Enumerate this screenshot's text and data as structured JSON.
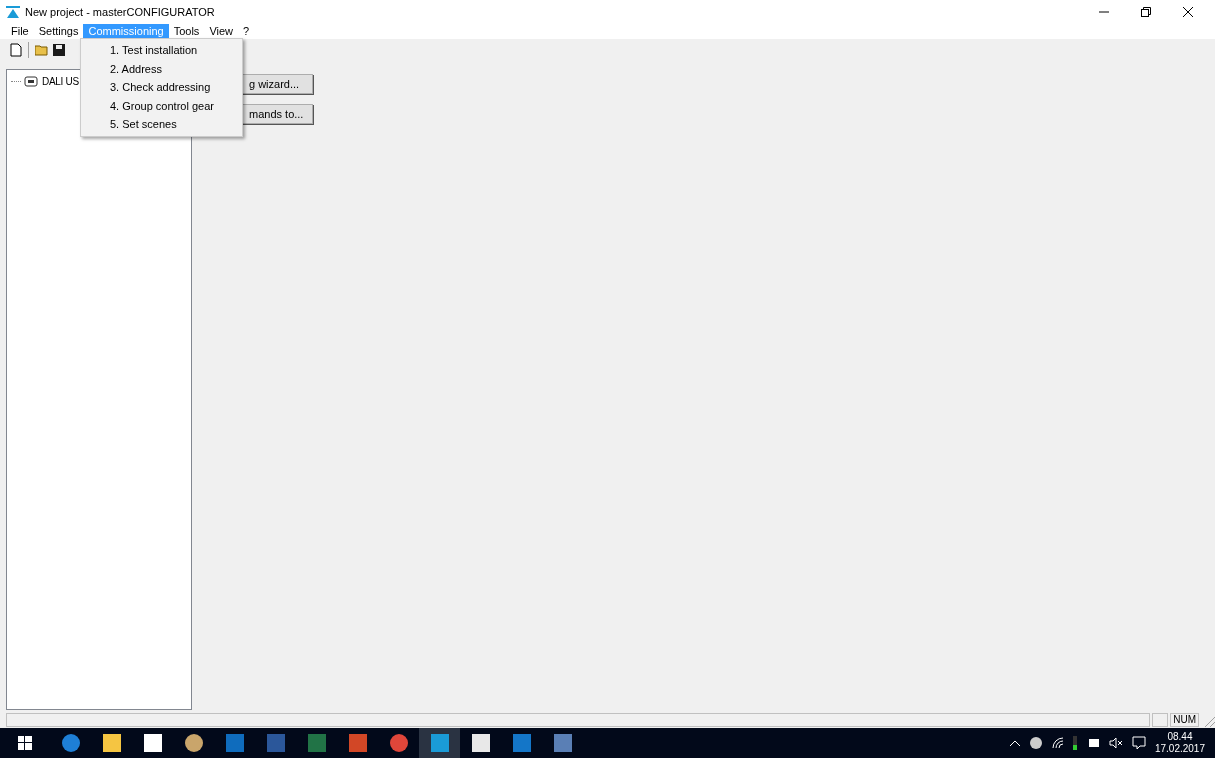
{
  "window": {
    "title": "New project - masterCONFIGURATOR"
  },
  "menu_bar": [
    {
      "label": "File",
      "selected": false
    },
    {
      "label": "Settings",
      "selected": false
    },
    {
      "label": "Commissioning",
      "selected": true
    },
    {
      "label": "Tools",
      "selected": false
    },
    {
      "label": "View",
      "selected": false
    },
    {
      "label": "?",
      "selected": false
    }
  ],
  "dropdown": [
    "1. Test installation",
    "2. Address",
    "3. Check addressing",
    "4. Group control gear",
    "5. Set scenes"
  ],
  "tree": [
    {
      "label": "DALI US"
    }
  ],
  "buttons": [
    "g wizard...",
    "mands to..."
  ],
  "status_bar": {
    "indicator": "NUM"
  },
  "taskbar": {
    "time": "08.44",
    "date": "17.02.2017"
  }
}
